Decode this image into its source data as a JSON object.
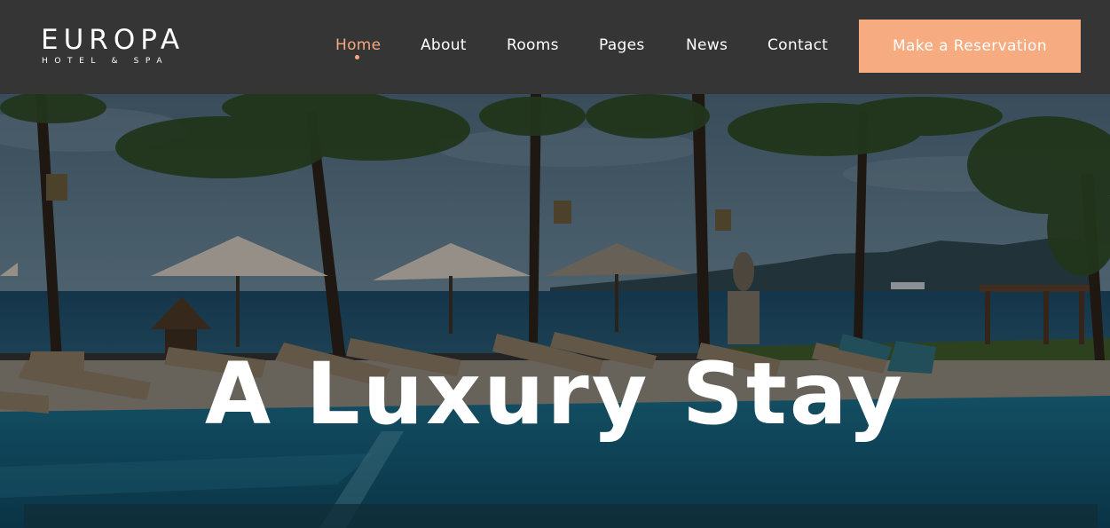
{
  "brand": {
    "name": "EUROPA",
    "tagline": "HOTEL & SPA"
  },
  "nav": {
    "items": [
      {
        "label": "Home",
        "active": true
      },
      {
        "label": "About",
        "active": false
      },
      {
        "label": "Rooms",
        "active": false
      },
      {
        "label": "Pages",
        "active": false
      },
      {
        "label": "News",
        "active": false
      },
      {
        "label": "Contact",
        "active": false
      }
    ],
    "reserve_label": "Make a Reservation"
  },
  "hero": {
    "title": "A Luxury Stay"
  },
  "colors": {
    "header_bg": "#353535",
    "accent": "#f7ab81",
    "active_nav": "#f5a97c"
  }
}
